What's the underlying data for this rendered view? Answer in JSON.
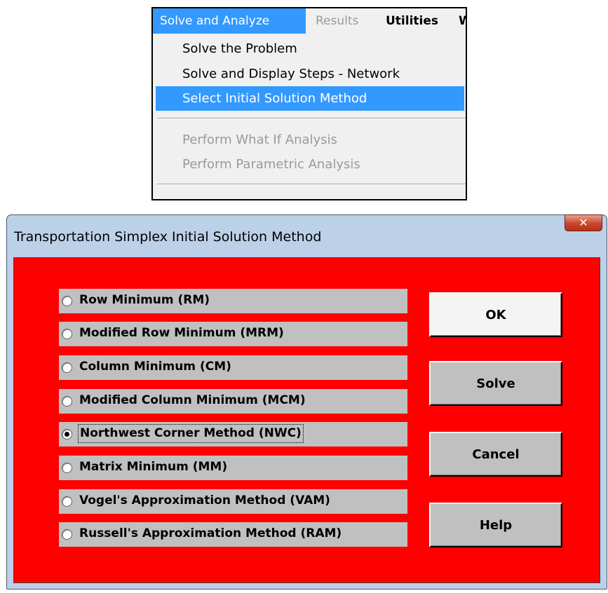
{
  "menubar": {
    "items": [
      "Solve and Analyze",
      "Results",
      "Utilities",
      "W"
    ]
  },
  "dropdown": {
    "items": [
      {
        "label": "Solve the Problem",
        "state": "enabled"
      },
      {
        "label": "Solve and Display Steps - Network",
        "state": "enabled"
      },
      {
        "label": "Select Initial Solution Method",
        "state": "highlighted"
      },
      {
        "label": "Perform What If Analysis",
        "state": "disabled"
      },
      {
        "label": "Perform Parametric Analysis",
        "state": "disabled"
      }
    ]
  },
  "dialog": {
    "title": "Transportation Simplex Initial Solution Method",
    "close_icon": "close-x-icon",
    "options": [
      {
        "label": "Row Minimum (RM)",
        "checked": false
      },
      {
        "label": "Modified Row Minimum (MRM)",
        "checked": false
      },
      {
        "label": "Column Minimum (CM)",
        "checked": false
      },
      {
        "label": "Modified Column Minimum (MCM)",
        "checked": false
      },
      {
        "label": "Northwest Corner Method (NWC)",
        "checked": true
      },
      {
        "label": "Matrix Minimum (MM)",
        "checked": false
      },
      {
        "label": "Vogel's Approximation Method (VAM)",
        "checked": false
      },
      {
        "label": "Russell's Approximation Method (RAM)",
        "checked": false
      }
    ],
    "buttons": {
      "ok": "OK",
      "solve": "Solve",
      "cancel": "Cancel",
      "help": "Help"
    }
  },
  "colors": {
    "menu_highlight": "#3399ff",
    "dialog_client": "#ff0000",
    "option_bg": "#c0c0c0",
    "disabled_text": "#9a9a9a"
  }
}
